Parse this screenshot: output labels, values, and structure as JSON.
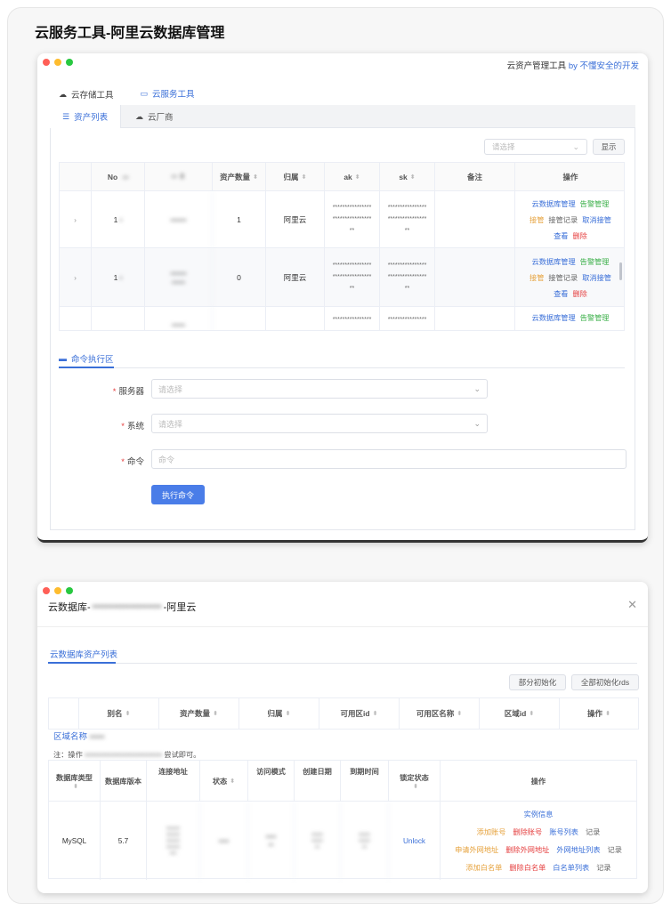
{
  "page_title": "云服务工具-阿里云数据库管理",
  "window1": {
    "title_prefix": "云资产管理工具",
    "title_by": "by 不懂安全的开发",
    "top_tabs": [
      {
        "label": "云存储工具",
        "icon": "cloud-icon"
      },
      {
        "label": "云服务工具",
        "icon": "monitor-icon"
      }
    ],
    "sub_tabs": [
      {
        "label": "资产列表",
        "icon": "list-icon"
      },
      {
        "label": "云厂商",
        "icon": "cloud-icon"
      }
    ],
    "filter_placeholder": "请选择",
    "show_button": "显示",
    "table": {
      "headers": [
        "No",
        "",
        "资产数量",
        "归属",
        "ak",
        "sk",
        "备注",
        "操作"
      ],
      "rows": [
        {
          "no": "1",
          "name": "",
          "count": "1",
          "owner": "阿里云",
          "ak_mask": [
            "****************",
            "****************",
            "**"
          ],
          "sk_mask": [
            "****************",
            "****************",
            "**"
          ]
        },
        {
          "no": "1",
          "name": "",
          "count": "0",
          "owner": "阿里云",
          "ak_mask": [
            "****************",
            "****************",
            "**"
          ],
          "sk_mask": [
            "****************",
            "****************",
            "**"
          ]
        },
        {
          "no": "",
          "name": "",
          "count": "",
          "owner": "",
          "ak_mask": [
            "****************"
          ],
          "sk_mask": [
            "****************"
          ]
        }
      ],
      "ops": {
        "db_manage": "云数据库管理",
        "alert_manage": "告警管理",
        "takeover": "接管",
        "takeover_log": "接管记录",
        "cancel_takeover": "取消接管",
        "view": "查看",
        "delete": "删除"
      }
    },
    "command_section": {
      "title": "命令执行区",
      "server_label": "服务器",
      "server_placeholder": "请选择",
      "system_label": "系统",
      "system_placeholder": "请选择",
      "command_label": "命令",
      "command_placeholder": "命令",
      "execute_button": "执行命令"
    }
  },
  "window2": {
    "title_prefix": "云数据库-",
    "title_suffix": "-阿里云",
    "tab": "云数据库资产列表",
    "partial_init": "部分初始化",
    "full_init": "全部初始化rds",
    "headers": [
      "别名",
      "资产数量",
      "归属",
      "可用区id",
      "可用区名称",
      "区域id",
      "操作"
    ],
    "region_label": "区域名称",
    "note_prefix": "注：操作",
    "note_suffix": "尝试即可。",
    "inner_headers": [
      "数据库类型",
      "数据库版本",
      "连接地址",
      "状态",
      "访问模式",
      "创建日期",
      "到期时间",
      "锁定状态",
      "操作"
    ],
    "inner_row": {
      "db_type": "MySQL",
      "version": "5.7",
      "lock_state": "Unlock"
    },
    "inner_ops": {
      "instance_info": "实例信息",
      "add_account": "添加账号",
      "delete_account": "删除账号",
      "account_list": "账号列表",
      "record": "记录",
      "apply_external": "申请外网地址",
      "delete_external": "删除外网地址",
      "external_list": "外网地址列表",
      "add_whitelist": "添加白名单",
      "delete_whitelist": "删除白名单",
      "whitelist_list": "白名单列表"
    }
  }
}
